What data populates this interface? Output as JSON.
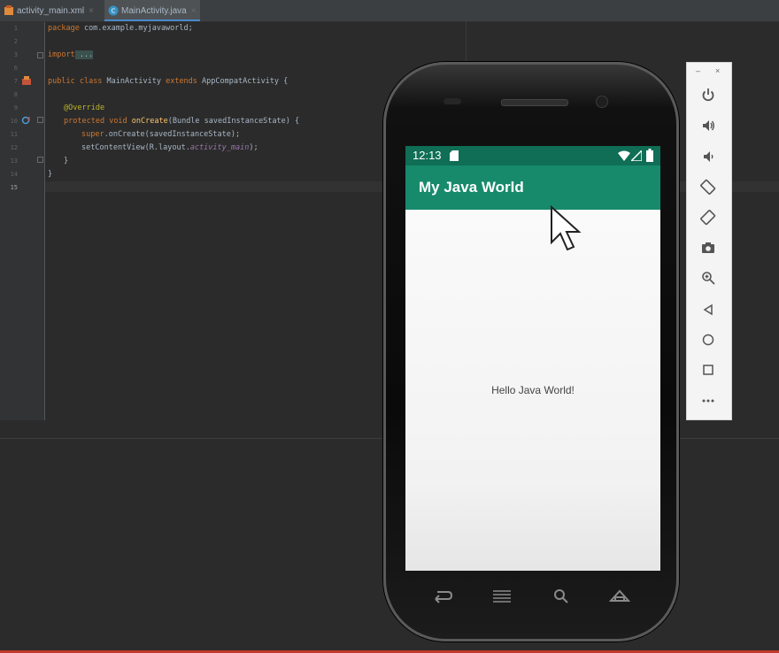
{
  "tabs": [
    {
      "label": "activity_main.xml",
      "active": false
    },
    {
      "label": "MainActivity.java",
      "active": true
    }
  ],
  "editor": {
    "line_numbers": [
      "1",
      "2",
      "3",
      "6",
      "7",
      "8",
      "9",
      "10",
      "11",
      "12",
      "13",
      "14",
      "15"
    ],
    "code": {
      "package_kw": "package",
      "package_name": " com.example.myjavaworld;",
      "import_kw": "import",
      "import_folded": " ...",
      "class_public": "public",
      "class_kw": " class",
      "class_name": " MainActivity",
      "extends_kw": " extends",
      "super_class": " AppCompatActivity {",
      "annotation": "@Override",
      "method_protected": "protected",
      "method_void": " void",
      "method_name": " onCreate",
      "method_params": "(Bundle savedInstanceState) {",
      "super_kw": "super",
      "super_call": ".onCreate(savedInstanceState);",
      "set_content": "setContentView(R.layout.",
      "layout_field": "activity_main",
      "set_content_end": ");",
      "close_method": "}",
      "close_class": "}"
    }
  },
  "phone": {
    "status_time": "12:13",
    "app_title": "My Java World",
    "hello_text": "Hello Java World!"
  },
  "emulator_toolbar": {
    "window_minimize": "–",
    "window_close": "×",
    "icons": [
      "power-icon",
      "volume-up-icon",
      "volume-down-icon",
      "rotate-left-icon",
      "rotate-right-icon",
      "camera-icon",
      "zoom-icon",
      "back-icon",
      "home-icon",
      "overview-icon",
      "more-icon"
    ]
  },
  "colors": {
    "status_bar": "#0f6e55",
    "app_bar": "#178a6c",
    "keyword": "#cc7832",
    "annotation": "#bbb529",
    "method": "#ffc66d"
  }
}
